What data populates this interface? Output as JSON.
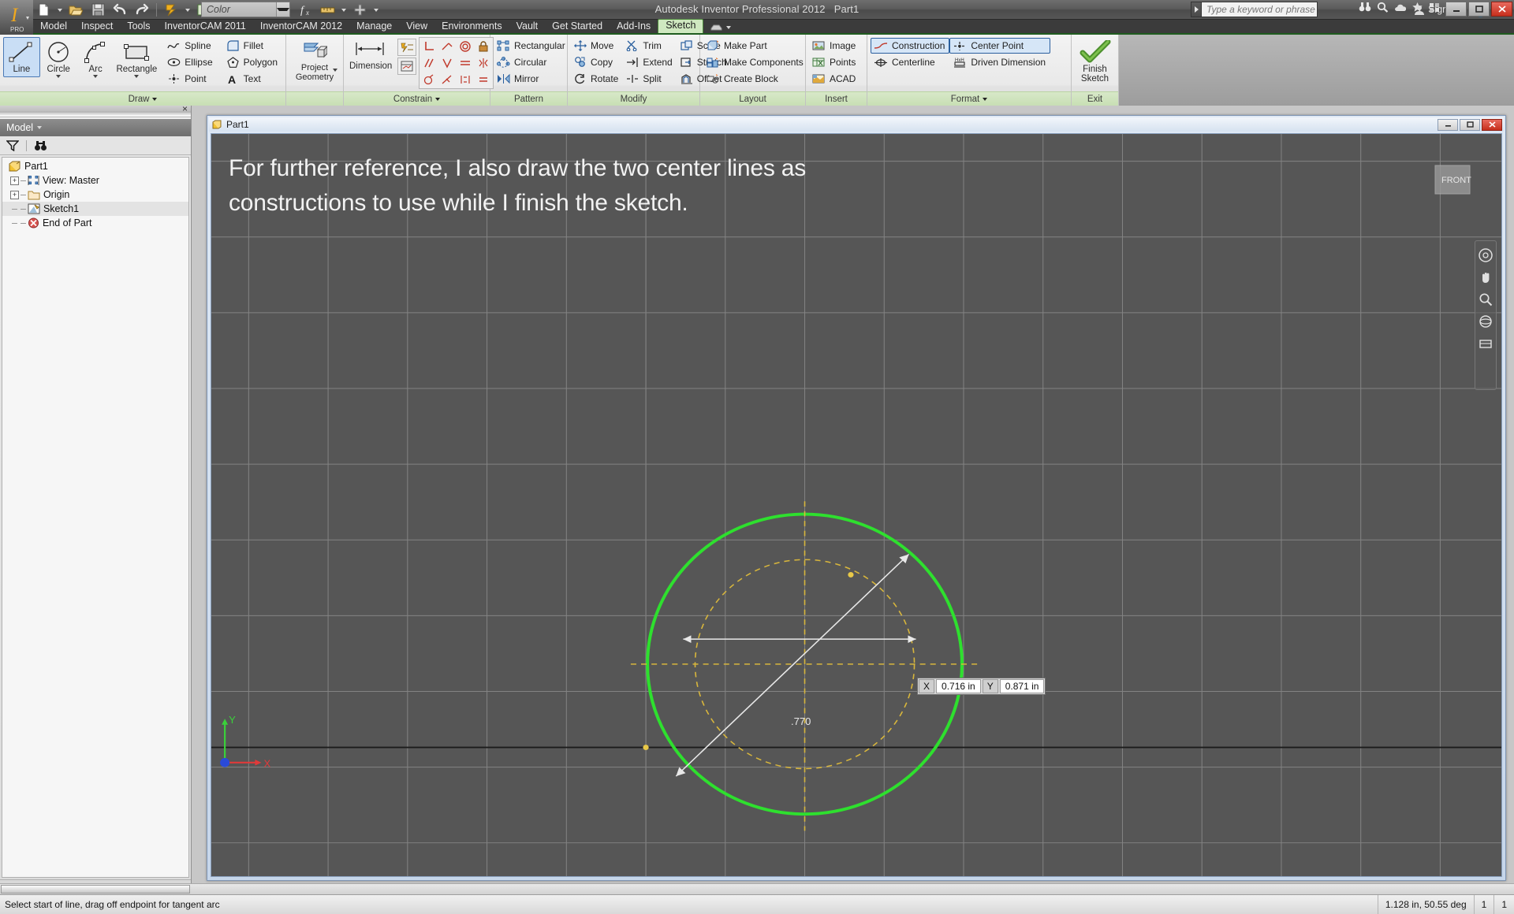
{
  "titlebar": {
    "app_title": "Autodesk Inventor Professional 2012",
    "doc_title": "Part1",
    "color_value": "Color",
    "search_placeholder": "Type a keyword or phrase",
    "sign_in": "Sign In",
    "quick_access": [
      {
        "name": "new",
        "label": "New"
      },
      {
        "name": "open",
        "label": "Open"
      },
      {
        "name": "save",
        "label": "Save"
      },
      {
        "name": "undo",
        "label": "Undo"
      },
      {
        "name": "redo",
        "label": "Redo"
      },
      {
        "name": "update",
        "label": "Update"
      },
      {
        "name": "select",
        "label": "Select"
      }
    ]
  },
  "menubar": {
    "items": [
      {
        "label": "Model",
        "active": false
      },
      {
        "label": "Inspect",
        "active": false
      },
      {
        "label": "Tools",
        "active": false
      },
      {
        "label": "InventorCAM 2011",
        "active": false
      },
      {
        "label": "InventorCAM 2012",
        "active": false
      },
      {
        "label": "Manage",
        "active": false
      },
      {
        "label": "View",
        "active": false
      },
      {
        "label": "Environments",
        "active": false
      },
      {
        "label": "Vault",
        "active": false
      },
      {
        "label": "Get Started",
        "active": false
      },
      {
        "label": "Add-Ins",
        "active": false
      },
      {
        "label": "Sketch",
        "active": true
      }
    ]
  },
  "ribbon": {
    "panels": [
      {
        "title": "Draw",
        "has_dropdown": true,
        "big": [
          {
            "label": "Line",
            "selected": true,
            "dropdown": false
          },
          {
            "label": "Circle",
            "selected": false,
            "dropdown": true
          },
          {
            "label": "Arc",
            "selected": false,
            "dropdown": true
          },
          {
            "label": "Rectangle",
            "selected": false,
            "dropdown": true
          }
        ],
        "small_a": [
          {
            "label": "Spline",
            "dropdown": true
          },
          {
            "label": "Ellipse",
            "dropdown": false
          },
          {
            "label": "Point",
            "dropdown": false
          }
        ],
        "small_b": [
          {
            "label": "Fillet",
            "dropdown": true
          },
          {
            "label": "Polygon",
            "dropdown": false
          },
          {
            "label": "Text",
            "dropdown": true
          }
        ]
      },
      {
        "title": "",
        "big": [
          {
            "label": "Project\nGeometry",
            "selected": false,
            "dropdown": true
          }
        ]
      },
      {
        "title": "Constrain",
        "has_dropdown": true,
        "big": [
          {
            "label": "Dimension",
            "selected": false,
            "dropdown": false
          }
        ]
      },
      {
        "title": "Pattern",
        "small_a": [
          {
            "label": "Rectangular"
          },
          {
            "label": "Circular"
          },
          {
            "label": "Mirror"
          }
        ]
      },
      {
        "title": "Modify",
        "small_a": [
          {
            "label": "Move"
          },
          {
            "label": "Copy"
          },
          {
            "label": "Rotate"
          }
        ],
        "small_b": [
          {
            "label": "Trim"
          },
          {
            "label": "Extend"
          },
          {
            "label": "Split"
          }
        ],
        "small_c": [
          {
            "label": "Scale"
          },
          {
            "label": "Stretch"
          },
          {
            "label": "Offset"
          }
        ]
      },
      {
        "title": "Layout",
        "small_a": [
          {
            "label": "Make Part"
          },
          {
            "label": "Make Components"
          },
          {
            "label": "Create Block"
          }
        ]
      },
      {
        "title": "Insert",
        "small_a": [
          {
            "label": "Image"
          },
          {
            "label": "Points"
          },
          {
            "label": "ACAD"
          }
        ]
      },
      {
        "title": "Format",
        "has_dropdown": true,
        "small_a": [
          {
            "label": "Construction",
            "on": true
          },
          {
            "label": "Centerline",
            "on": false
          }
        ],
        "small_b": [
          {
            "label": "Center Point",
            "on": true
          },
          {
            "label": "Driven Dimension",
            "on": false
          }
        ]
      },
      {
        "title": "Exit",
        "big": [
          {
            "label": "Finish\nSketch",
            "selected": false,
            "dropdown": false
          }
        ]
      }
    ]
  },
  "browser": {
    "header": "Model",
    "tree": [
      {
        "label": "Part1",
        "indent": 0,
        "expander": "none",
        "icon": "part-icon",
        "selected": false
      },
      {
        "label": "View: Master",
        "indent": 1,
        "expander": "plus",
        "icon": "view-icon",
        "selected": false
      },
      {
        "label": "Origin",
        "indent": 1,
        "expander": "plus",
        "icon": "folder-icon",
        "selected": false
      },
      {
        "label": "Sketch1",
        "indent": 1,
        "expander": "dash",
        "icon": "sketch-icon",
        "selected": true
      },
      {
        "label": "End of Part",
        "indent": 1,
        "expander": "dash",
        "icon": "end-of-part-icon",
        "selected": false
      }
    ]
  },
  "document": {
    "tab_title": "Part1",
    "overlay_text": "For further reference, I also draw the two center lines as constructions to use while I finish the sketch.",
    "view_cube_label": "FRONT",
    "coordinate_tip": {
      "x_key": "X",
      "x_value": "0.716 in",
      "y_key": "Y",
      "y_value": "0.871 in"
    },
    "dimension_label": ".770"
  },
  "statusbar": {
    "message": "Select start of line, drag off endpoint for tangent arc",
    "coordinate_readout": "1.128 in, 50.55 deg",
    "cell_a": "1",
    "cell_b": "1"
  },
  "colors": {
    "accent_green": "#00e000",
    "construction_yellow": "#d8b63c",
    "ribbon_panel_title": "#cfe1ba",
    "canvas_bg": "#565656",
    "selection_blue": "#c9def5"
  }
}
